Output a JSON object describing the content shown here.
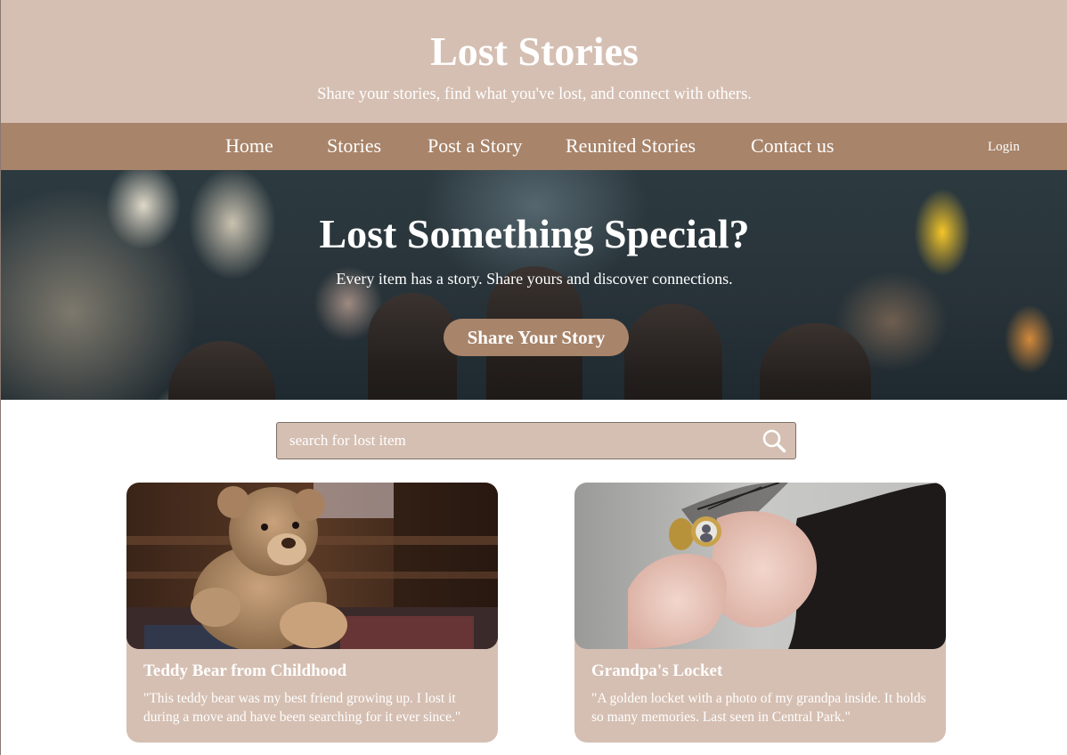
{
  "header": {
    "title": "Lost Stories",
    "tagline": "Share your stories, find what you've lost, and connect with others."
  },
  "nav": {
    "items": [
      {
        "label": "Home"
      },
      {
        "label": "Stories"
      },
      {
        "label": "Post a Story"
      },
      {
        "label": "Reunited Stories"
      },
      {
        "label": "Contact us"
      }
    ],
    "login": "Login"
  },
  "hero": {
    "title": "Lost Something Special?",
    "subtitle": "Every item has a story. Share yours and discover connections.",
    "cta_label": "Share Your Story"
  },
  "search": {
    "placeholder": "search for lost item",
    "value": "",
    "icon": "search-icon"
  },
  "stories": [
    {
      "title": "Teddy Bear from Childhood",
      "excerpt": "\"This teddy bear was my best friend growing up. I lost it during a move and have been searching for it ever since.\"",
      "image": "teddy-bear-photo"
    },
    {
      "title": "Grandpa's Locket",
      "excerpt": "\"A golden locket with a photo of my grandpa inside. It holds so many memories. Last seen in Central Park.\"",
      "image": "locket-photo"
    }
  ],
  "colors": {
    "header_bg": "#d5bfb2",
    "nav_bg": "#a8846a",
    "accent": "#a8846a",
    "card_bg": "#d5bfb2",
    "text_on_brand": "#ffffff"
  }
}
